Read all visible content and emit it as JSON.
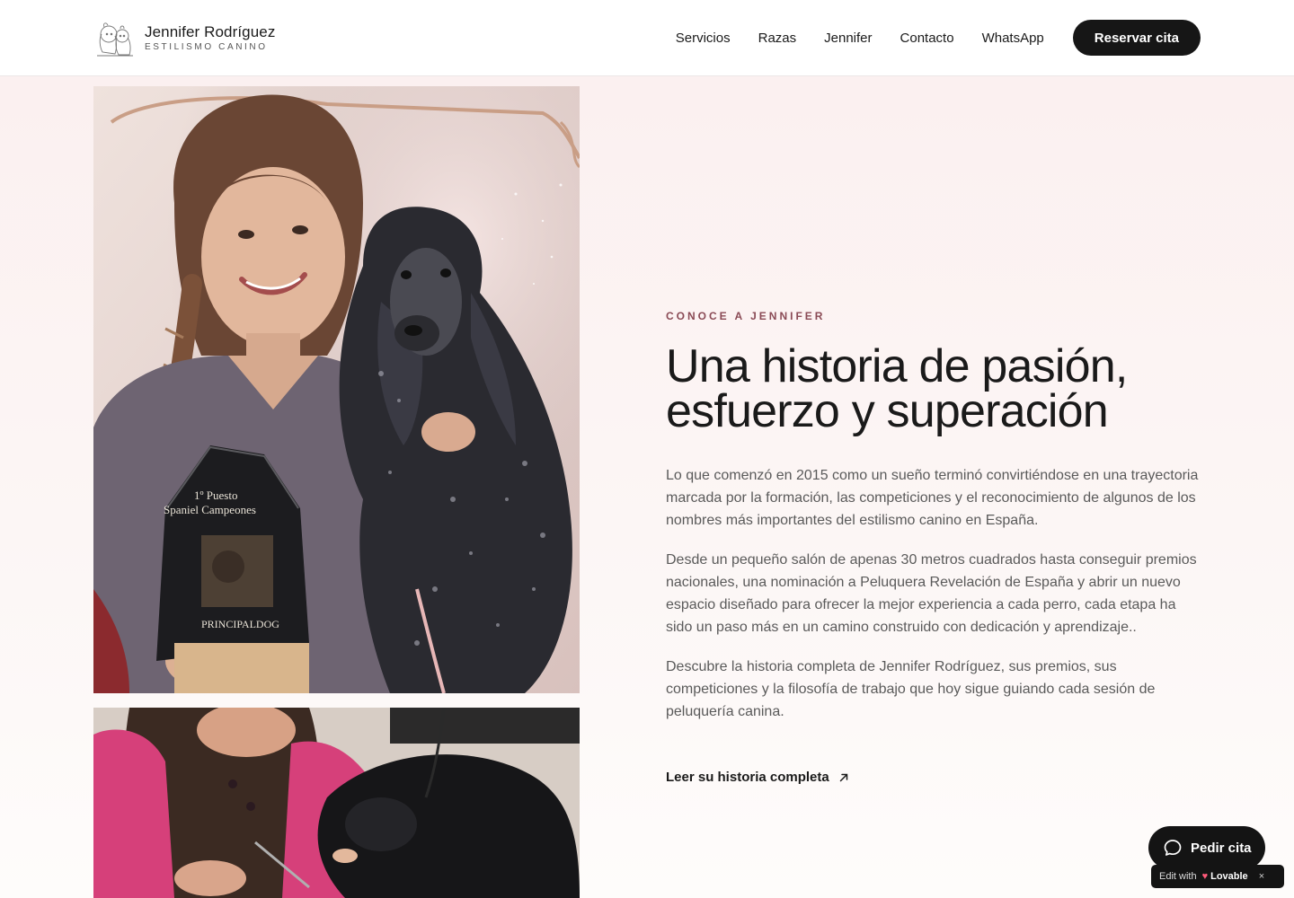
{
  "header": {
    "brand_name": "Jennifer Rodríguez",
    "brand_sub": "ESTILISMO CANINO",
    "nav": [
      "Servicios",
      "Razas",
      "Jennifer",
      "Contacto",
      "WhatsApp"
    ],
    "cta_label": "Reservar cita"
  },
  "about": {
    "eyebrow": "CONOCE A JENNIFER",
    "headline_line1": "Una historia de pasión,",
    "headline_line2": "esfuerzo y superación",
    "paragraphs": [
      "Lo que comenzó en 2015 como un sueño terminó convirtiéndose en una trayectoria marcada por la formación, las competiciones y el reconocimiento de algunos de los nombres más importantes del estilismo canino en España.",
      "Desde un pequeño salón de apenas 30 metros cuadrados hasta conseguir premios nacionales, una nominación a Peluquera Revelación de España y abrir un nuevo espacio diseñado para ofrecer la mejor experiencia a cada perro, cada etapa ha sido un paso más en un camino construido con dedicación y aprendizaje..",
      "Descubre la historia completa de Jennifer Rodríguez, sus premios, sus competiciones y la filosofía de trabajo que hoy sigue guiando cada sesión de peluquería canina."
    ],
    "read_more": "Leer su historia completa",
    "trophy_line1": "1º Puesto",
    "trophy_line2": "Spaniel Campeones",
    "trophy_brand": "PRINCIPALDOG"
  },
  "floating": {
    "fab_label": "Pedir cita",
    "lovable_edit": "Edit with",
    "lovable_brand": "Lovable",
    "lovable_close": "×"
  },
  "colors": {
    "accent_eyebrow": "#8a4a55",
    "cta_bg": "#161616",
    "section_bg": "#fbf0f0"
  }
}
